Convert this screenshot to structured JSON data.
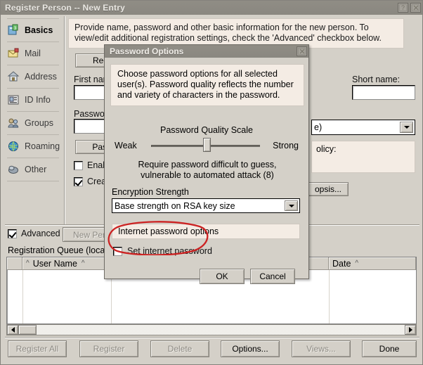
{
  "window": {
    "title": "Register Person -- New Entry",
    "help_button": "?",
    "close_button": "×"
  },
  "sidebar": {
    "items": [
      {
        "label": "Basics",
        "icon": "basics-icon",
        "active": true
      },
      {
        "label": "Mail",
        "icon": "mail-icon",
        "active": false
      },
      {
        "label": "Address",
        "icon": "address-icon",
        "active": false
      },
      {
        "label": "ID Info",
        "icon": "id-info-icon",
        "active": false
      },
      {
        "label": "Groups",
        "icon": "groups-icon",
        "active": false
      },
      {
        "label": "Roaming",
        "icon": "roaming-icon",
        "active": false
      },
      {
        "label": "Other",
        "icon": "other-icon",
        "active": false
      }
    ]
  },
  "main": {
    "banner": "Provide name, password and other basic information for the new person.  To view/edit additional registration settings, check the 'Advanced' checkbox below.",
    "registration_button": "Registr",
    "first_name_label": "First name:",
    "first_name_value": "",
    "short_name_label": "Short name:",
    "short_name_value": "",
    "password_label": "Password",
    "password_value": "",
    "password_button": "Passw",
    "combo_value": "e)",
    "policy_label": "olicy:",
    "synopsis_button": "opsis...",
    "enable_checkbox_label": "Enable",
    "enable_checked": false,
    "create_checkbox_label": "Create",
    "create_checked": true,
    "advanced_label": "Advanced",
    "advanced_checked": true,
    "new_person_button": "New Pers",
    "queue_label": "Registration Queue (local):",
    "columns": [
      "",
      "User Name",
      "Date"
    ],
    "rows": []
  },
  "footer": {
    "buttons": [
      {
        "label": "Register All",
        "enabled": false
      },
      {
        "label": "Register",
        "enabled": false
      },
      {
        "label": "Delete",
        "enabled": false
      },
      {
        "label": "Options...",
        "enabled": true
      },
      {
        "label": "Views...",
        "enabled": false
      },
      {
        "label": "Done",
        "enabled": true
      }
    ]
  },
  "dialog": {
    "title": "Password Options",
    "close_button": "×",
    "info": "Choose password options for all selected user(s). Password quality reflects the number and variety of characters in the password.",
    "quality_scale_title": "Password Quality Scale",
    "weak_label": "Weak",
    "strong_label": "Strong",
    "slider_percent": 51,
    "quality_description": "Require password difficult to guess, vulnerable to automated attack (8)",
    "quality_value": 8,
    "encryption_label": "Encryption Strength",
    "encryption_value": "Base strength on RSA key size",
    "internet_group_label": "Internet password options",
    "set_internet_password_label": "Set internet password",
    "set_internet_password_checked": false,
    "ok_button": "OK",
    "cancel_button": "Cancel"
  },
  "annotation": {
    "type": "hand-drawn-ellipse",
    "color": "#cc2222",
    "targets": "Set internet password"
  },
  "colors": {
    "face": "#d4d0c8",
    "titlebar": "#8f8c84",
    "banner": "#f4ece4",
    "annotation_red": "#cc2222"
  }
}
